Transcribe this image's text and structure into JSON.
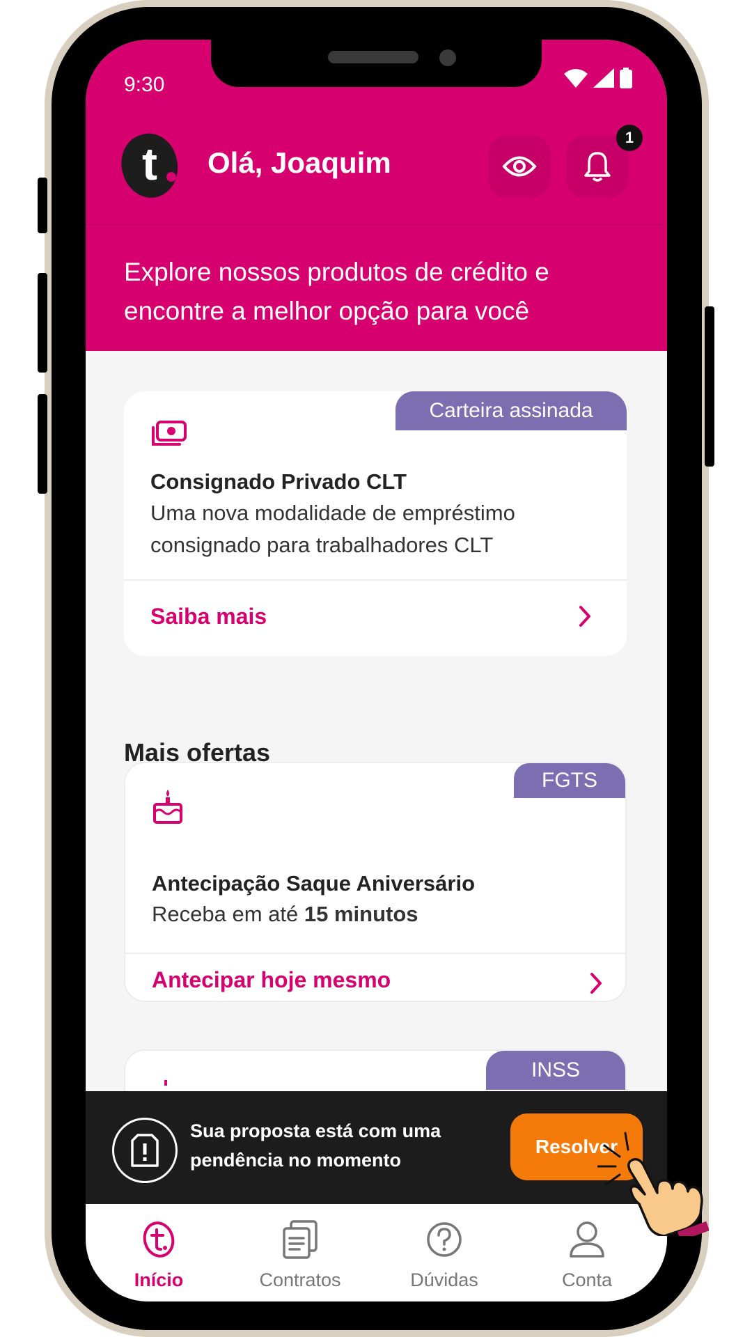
{
  "status_bar": {
    "time": "9:30"
  },
  "header": {
    "greeting": "Olá,  Joaquim",
    "notification_count": "1",
    "tagline": "Explore nossos produtos de crédito e encontre a melhor opção para você"
  },
  "main_card": {
    "tag": "Carteira assinada",
    "icon": "money-icon",
    "title": "Consignado Privado CLT",
    "description": "Uma nova modalidade de empréstimo consignado para trabalhadores CLT",
    "link": "Saiba mais"
  },
  "section_title": "Mais ofertas",
  "fgts_card": {
    "tag": "FGTS",
    "icon": "birthday-cake-icon",
    "title": "Antecipação Saque Aniversário",
    "description_prefix": "Receba em até ",
    "description_bold": "15 minutos",
    "link": "Antecipar hoje mesmo"
  },
  "inss_card": {
    "tag": "INSS"
  },
  "pending_banner": {
    "text": "Sua proposta está com  uma pendência no momento",
    "button": "Resolver"
  },
  "bottom_nav": {
    "items": [
      {
        "label": "Início",
        "icon": "home-t-icon",
        "active": true
      },
      {
        "label": "Contratos",
        "icon": "contracts-icon",
        "active": false
      },
      {
        "label": "Dúvidas",
        "icon": "help-icon",
        "active": false
      },
      {
        "label": "Conta",
        "icon": "account-icon",
        "active": false
      }
    ]
  },
  "colors": {
    "brand": "#d6006f",
    "tag": "#7b6fb1",
    "action": "#f47b0a",
    "banner": "#1c1c1c"
  }
}
